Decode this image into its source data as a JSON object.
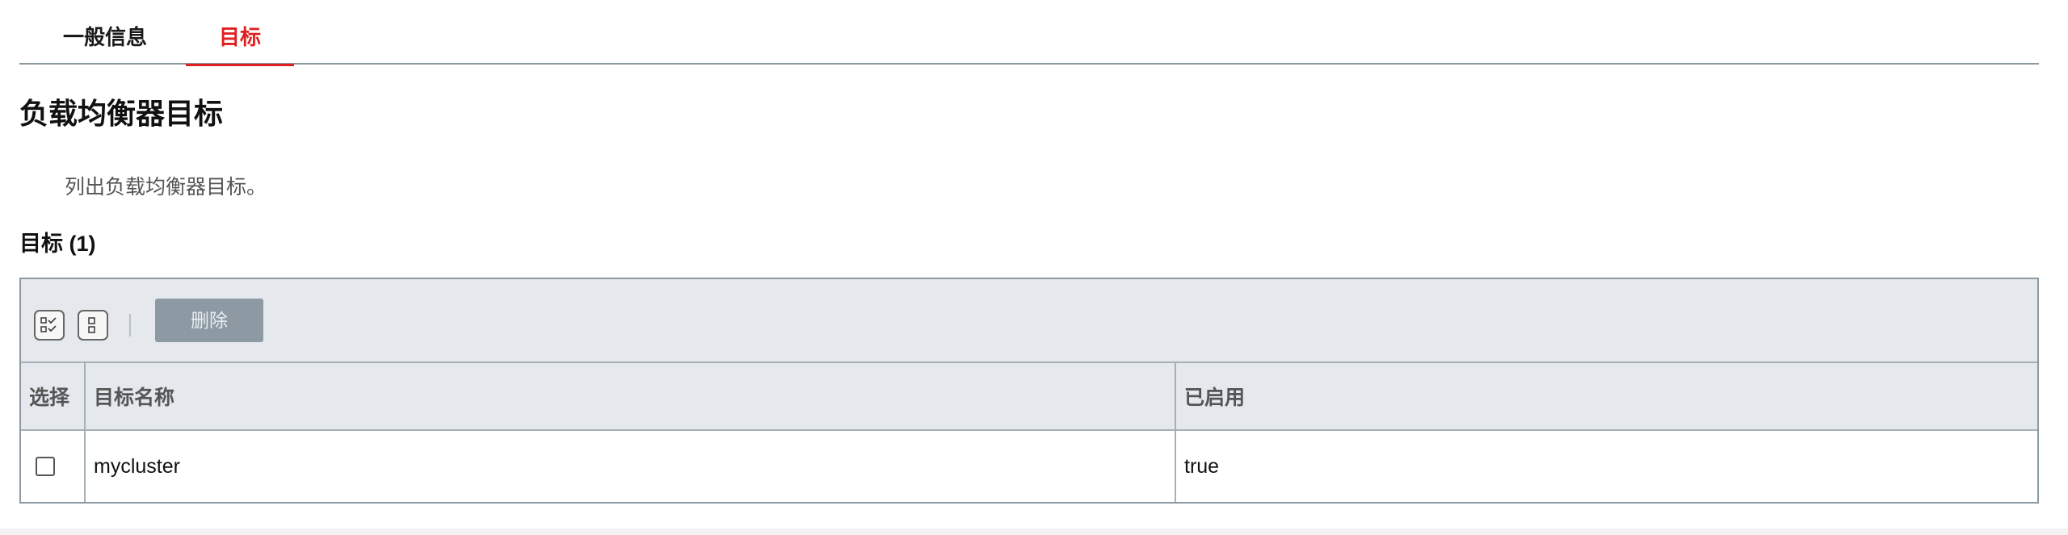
{
  "tabs": {
    "general_label": "一般信息",
    "target_label": "目标"
  },
  "page": {
    "title": "负载均衡器目标",
    "description": "列出负载均衡器目标。",
    "section_title": "目标 (1)"
  },
  "toolbar": {
    "delete_label": "删除",
    "select_all_icon": "select-all-icon",
    "deselect_icon": "deselect-all-icon"
  },
  "table": {
    "headers": {
      "select": "选择",
      "name": "目标名称",
      "enabled": "已启用"
    },
    "rows": [
      {
        "name": "mycluster",
        "enabled": "true",
        "checked": false
      }
    ]
  },
  "colors": {
    "accent": "#e02020",
    "toolbar_bg": "#e5e8ec",
    "disabled_button": "#8d9aa3"
  }
}
